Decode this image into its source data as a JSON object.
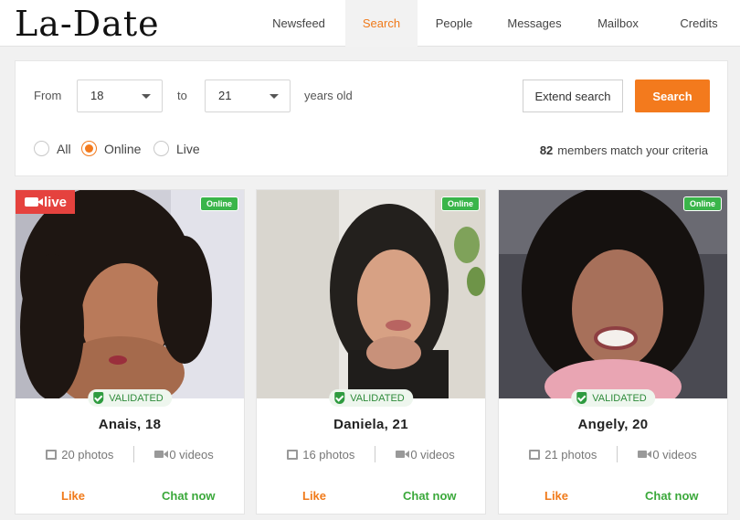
{
  "brand": {
    "logo": "La-Date"
  },
  "nav": [
    {
      "label": "Newsfeed",
      "active": false
    },
    {
      "label": "Search",
      "active": true
    },
    {
      "label": "People",
      "active": false
    },
    {
      "label": "Messages",
      "active": false
    },
    {
      "label": "Mailbox",
      "active": false
    },
    {
      "label": "Credits",
      "active": false
    }
  ],
  "search": {
    "from_label": "From",
    "from_value": "18",
    "to_label": "to",
    "to_value": "21",
    "suffix": "years old",
    "extend_button": "Extend search",
    "search_button": "Search",
    "filters": [
      {
        "label": "All",
        "checked": false
      },
      {
        "label": "Online",
        "checked": true
      },
      {
        "label": "Live",
        "checked": false
      }
    ],
    "match_count": "82",
    "match_text": "members match your criteria"
  },
  "cards": [
    {
      "name": "Anais, 18",
      "online_badge": "Online",
      "live_badge": "live",
      "validated": "VALIDATED",
      "photos": "20 photos",
      "videos": "0 videos",
      "like": "Like",
      "chat": "Chat now"
    },
    {
      "name": "Daniela, 21",
      "online_badge": "Online",
      "validated": "VALIDATED",
      "photos": "16 photos",
      "videos": "0 videos",
      "like": "Like",
      "chat": "Chat now"
    },
    {
      "name": "Angely, 20",
      "online_badge": "Online",
      "validated": "VALIDATED",
      "photos": "21 photos",
      "videos": "0 videos",
      "like": "Like",
      "chat": "Chat now"
    }
  ],
  "colors": {
    "accent": "#f37a1d",
    "online": "#3ab54a",
    "live": "#e5423e",
    "chat": "#3aa83a"
  }
}
